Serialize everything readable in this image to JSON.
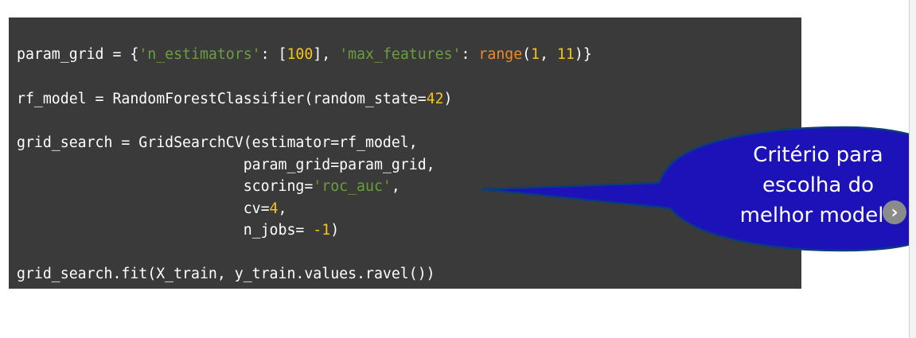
{
  "code": {
    "lines": [
      [
        {
          "t": "param_grid = {",
          "c": "plain"
        },
        {
          "t": "'n_estimators'",
          "c": "str"
        },
        {
          "t": ": [",
          "c": "plain"
        },
        {
          "t": "100",
          "c": "num"
        },
        {
          "t": "], ",
          "c": "plain"
        },
        {
          "t": "'max_features'",
          "c": "str"
        },
        {
          "t": ": ",
          "c": "plain"
        },
        {
          "t": "range",
          "c": "fn"
        },
        {
          "t": "(",
          "c": "plain"
        },
        {
          "t": "1",
          "c": "num"
        },
        {
          "t": ", ",
          "c": "plain"
        },
        {
          "t": "11",
          "c": "num"
        },
        {
          "t": ")}",
          "c": "plain"
        }
      ],
      [
        {
          "t": "rf_model = RandomForestClassifier(random_state=",
          "c": "plain"
        },
        {
          "t": "42",
          "c": "num"
        },
        {
          "t": ")",
          "c": "plain"
        }
      ],
      [
        {
          "t": "grid_search = GridSearchCV(estimator=rf_model,",
          "c": "plain"
        }
      ],
      [
        {
          "t": "                          param_grid=param_grid,",
          "c": "plain"
        }
      ],
      [
        {
          "t": "                          scoring=",
          "c": "plain"
        },
        {
          "t": "'roc_auc'",
          "c": "str"
        },
        {
          "t": ",",
          "c": "plain"
        }
      ],
      [
        {
          "t": "                          cv=",
          "c": "plain"
        },
        {
          "t": "4",
          "c": "num"
        },
        {
          "t": ",",
          "c": "plain"
        }
      ],
      [
        {
          "t": "                          n_jobs= ",
          "c": "plain"
        },
        {
          "t": "-1",
          "c": "num"
        },
        {
          "t": ")",
          "c": "plain"
        }
      ],
      [
        {
          "t": "grid_search.fit(X_train, y_train.values.ravel())",
          "c": "plain"
        }
      ]
    ]
  },
  "callout": {
    "line1": "Critério para",
    "line2": "escolha do",
    "line3": "melhor modelo"
  },
  "nav": {
    "next_glyph": "›"
  },
  "colors": {
    "panel_bg": "#3a3a3a",
    "string": "#6a9f3c",
    "number": "#f5c518",
    "builtin": "#f08a24",
    "callout_fill": "#1c12b8",
    "callout_stroke": "#0a3d7a"
  }
}
